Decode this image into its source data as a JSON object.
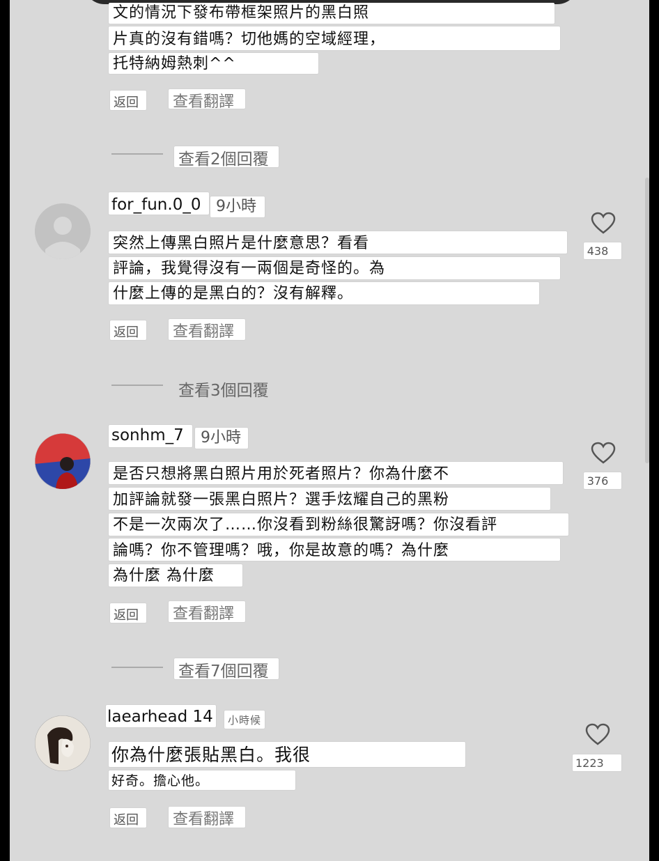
{
  "comment0": {
    "lines": [
      "文的情況下發布帶框架照片的黑白照",
      "片真的沒有錯嗎？切他媽的空域經理，",
      "托特納姆熱刺^^"
    ],
    "reply": "返回",
    "translate": "查看翻譯",
    "view_replies": "查看2個回覆"
  },
  "comment1": {
    "username": "for_fun.0_0",
    "time": "9小時",
    "lines": [
      "突然上傳黑白照片是什麼意思？看看",
      "評論，我覺得沒有一兩個是奇怪的。為",
      "什麼上傳的是黑白的？沒有解釋。"
    ],
    "likes": "438",
    "reply": "返回",
    "translate": "查看翻譯",
    "view_replies": "查看3個回覆"
  },
  "comment2": {
    "username": "sonhm_7",
    "time": "9小時",
    "lines": [
      "是否只想將黑白照片用於死者照片？你為什麼不",
      "加評論就發一張黑白照片？選手炫耀自己的黑粉",
      "不是一次兩次了……你沒看到粉絲很驚訝嗎？你沒看評",
      "論嗎？你不管理嗎？哦，你是故意的嗎？為什麼",
      "為什麼 為什麼"
    ],
    "likes": "376",
    "reply": "返回",
    "translate": "查看翻譯",
    "view_replies": "查看7個回覆"
  },
  "comment3": {
    "username": "laearhead 14",
    "time": "小時候",
    "lines": [
      "你為什麼張貼黑白。我很",
      "好奇。擔心他。"
    ],
    "likes": "1223",
    "reply": "返回",
    "translate": "查看翻譯"
  }
}
